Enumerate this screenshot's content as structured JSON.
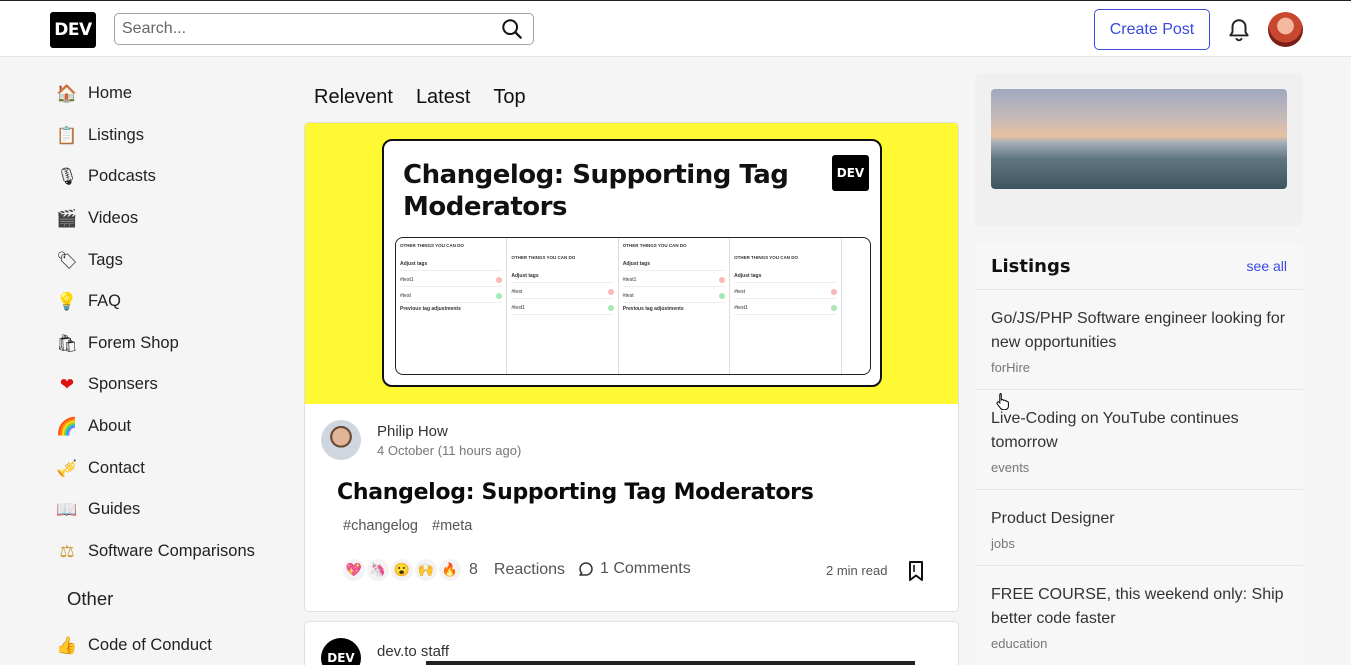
{
  "header": {
    "logo": "DEV",
    "search_placeholder": "Search...",
    "create_post": "Create Post"
  },
  "sidebar": {
    "items": [
      {
        "label": "Home",
        "icon": "🏠"
      },
      {
        "label": "Listings",
        "icon": "📋"
      },
      {
        "label": "Podcasts",
        "icon": "🎙"
      },
      {
        "label": "Videos",
        "icon": "🎬"
      },
      {
        "label": "Tags",
        "icon": "🏷"
      },
      {
        "label": "FAQ",
        "icon": "💡"
      },
      {
        "label": "Forem Shop",
        "icon": "🛍"
      },
      {
        "label": "Sponsers",
        "icon": "❤"
      },
      {
        "label": "About",
        "icon": "🌈"
      },
      {
        "label": "Contact",
        "icon": "🎺"
      },
      {
        "label": "Guides",
        "icon": "📖"
      },
      {
        "label": "Software Comparisons",
        "icon": "⚖"
      }
    ],
    "other_title": "Other",
    "other_items": [
      {
        "label": "Code of Conduct",
        "icon": "👍"
      }
    ]
  },
  "tabs": [
    "Relevent",
    "Latest",
    "Top"
  ],
  "post": {
    "cover_title": "Changelog: Supporting Tag Moderators",
    "cover_logo": "DEV",
    "author": "Philip How",
    "date": "4 October  (11 hours ago)",
    "title": "Changelog: Supporting Tag Moderators",
    "tags": [
      "#changelog",
      "#meta"
    ],
    "reaction_icons": [
      "💖",
      "🦄",
      "😮",
      "🙌",
      "🔥"
    ],
    "reaction_count": "8",
    "reaction_label": "Reactions",
    "comments": "1 Comments",
    "read_time": "2 min read"
  },
  "post2": {
    "avatar": "DEV",
    "author": "dev.to staff"
  },
  "cover_shot": {
    "heading": "OTHER THINGS YOU CAN DO",
    "adjust": "Adjust tags",
    "tag1": "#test1",
    "tag2": "#test",
    "prev": "Previous tag adjustments"
  },
  "listings": {
    "title": "Listings",
    "see_all": "see all",
    "items": [
      {
        "title": "Go/JS/PHP Software engineer looking for new opportunities",
        "category": "forHire"
      },
      {
        "title": "Live-Coding on YouTube continues tomorrow",
        "category": "events"
      },
      {
        "title": "Product Designer",
        "category": "jobs"
      },
      {
        "title": "FREE COURSE, this weekend only: Ship better code faster",
        "category": "education"
      }
    ]
  },
  "colors": {
    "accent": "#3b49df",
    "cover_bg": "#fff933"
  }
}
